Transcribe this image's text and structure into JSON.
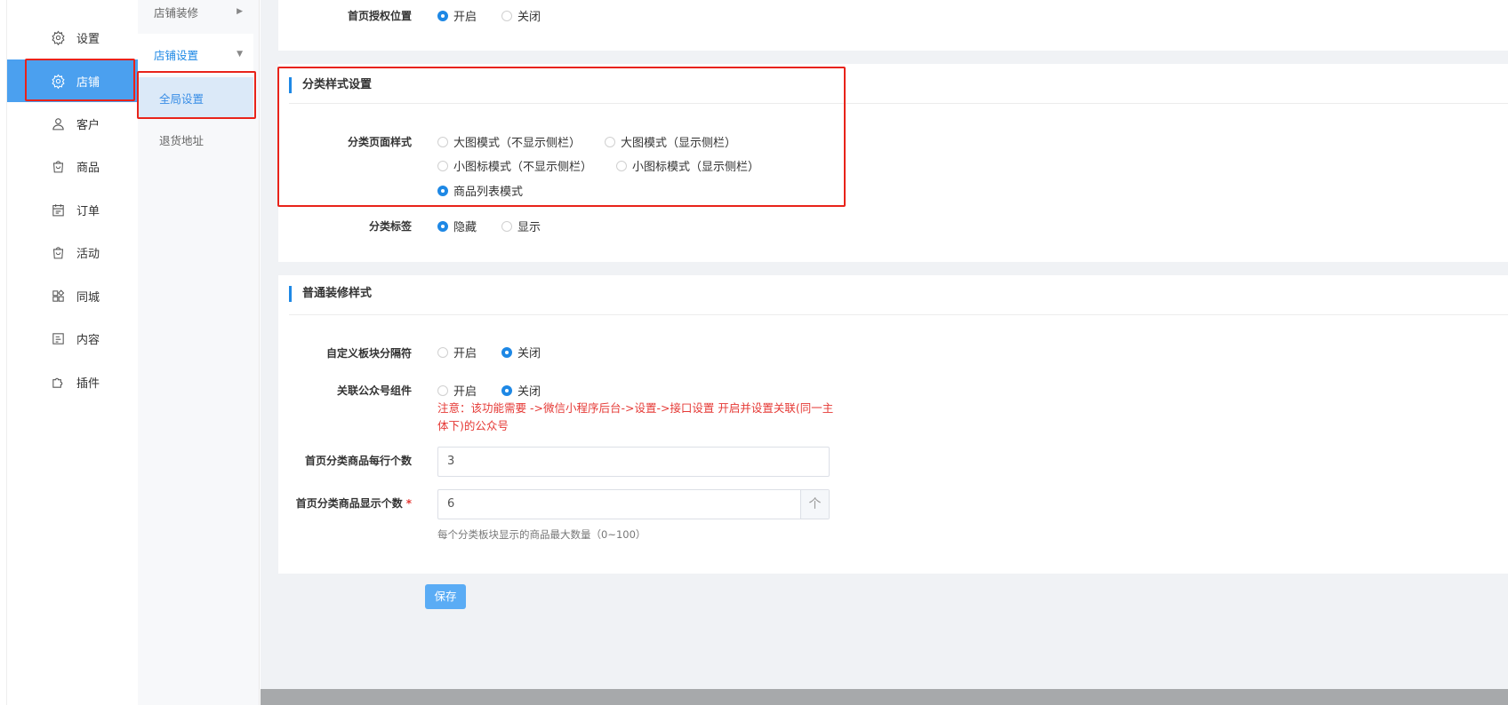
{
  "sidebar": {
    "items": [
      {
        "label": "设置",
        "icon": "gear-icon"
      },
      {
        "label": "店铺",
        "icon": "gear-icon"
      },
      {
        "label": "客户",
        "icon": "user-icon"
      },
      {
        "label": "商品",
        "icon": "shopping-bag-icon"
      },
      {
        "label": "订单",
        "icon": "calendar-icon"
      },
      {
        "label": "活动",
        "icon": "bag-icon"
      },
      {
        "label": "同城",
        "icon": "grid-icon"
      },
      {
        "label": "内容",
        "icon": "document-icon"
      },
      {
        "label": "插件",
        "icon": "puzzle-icon"
      }
    ],
    "active_index": 1,
    "active_color": "#4ba0ef"
  },
  "subnav": {
    "items": [
      {
        "label": "店铺装修",
        "arrow": "▶"
      },
      {
        "label": "店铺设置",
        "arrow": "▼"
      },
      {
        "label": "全局设置"
      },
      {
        "label": "退货地址"
      }
    ]
  },
  "section_top": {
    "homepage_auth_label": "首页授权位置",
    "options": [
      "开启",
      "关闭"
    ],
    "selected": "开启"
  },
  "section_category": {
    "title": "分类样式设置",
    "page_style_label": "分类页面样式",
    "page_style_options": [
      "大图模式（不显示侧栏）",
      "大图模式（显示侧栏）",
      "小图标模式（不显示侧栏）",
      "小图标模式（显示侧栏）",
      "商品列表模式"
    ],
    "page_style_selected": "商品列表模式",
    "tag_label": "分类标签",
    "tag_options": [
      "隐藏",
      "显示"
    ],
    "tag_selected": "隐藏"
  },
  "section_decor": {
    "title": "普通装修样式",
    "separator_label": "自定义板块分隔符",
    "separator_options": [
      "开启",
      "关闭"
    ],
    "separator_selected": "关闭",
    "official_label": "关联公众号组件",
    "official_options": [
      "开启",
      "关闭"
    ],
    "official_selected": "关闭",
    "note": "注意：该功能需要 ->微信小程序后台->设置->接口设置 开启并设置关联(同一主体下)的公众号",
    "per_row_label": "首页分类商品每行个数",
    "per_row_value": "3",
    "display_count_label": "首页分类商品显示个数",
    "required_mark": "*",
    "display_count_value": "6",
    "stepper_up": "个",
    "display_count_hint": "每个分类板块显示的商品最大数量（0~100）"
  },
  "actions": {
    "save_label": "保存"
  },
  "colors": {
    "accent": "#1e88e5",
    "highlight": "#e8231a",
    "note": "#e53935"
  }
}
